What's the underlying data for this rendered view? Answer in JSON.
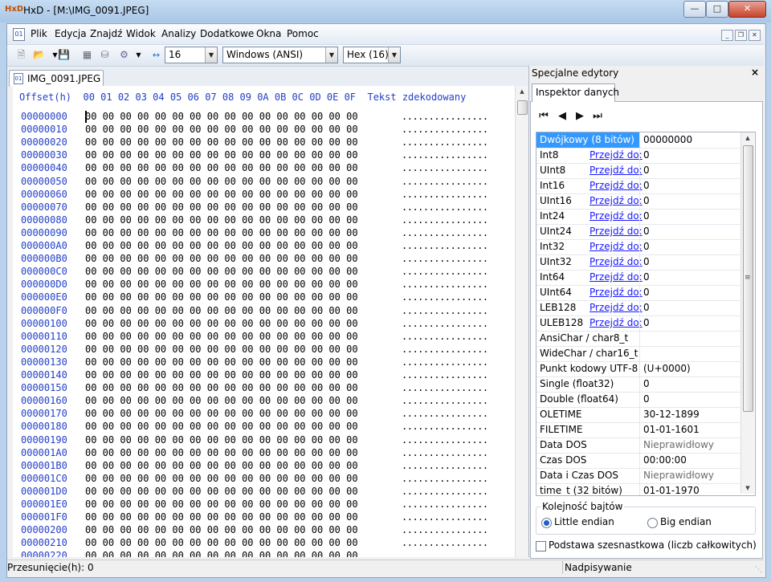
{
  "window": {
    "title": "HxD - [M:\\IMG_0091.JPEG]",
    "app_icon": "HxD"
  },
  "menu": [
    "Plik",
    "Edycja",
    "Znajdź",
    "Widok",
    "Analizy",
    "Dodatkowe",
    "Okna",
    "Pomoc"
  ],
  "toolbar": {
    "bytes_per_row": "16",
    "charset": "Windows (ANSI)",
    "offset_base": "Hex (16)"
  },
  "file_tab": {
    "label": "IMG_0091.JPEG"
  },
  "hex_view": {
    "header": "Offset(h)  00 01 02 03 04 05 06 07 08 09 0A 0B 0C 0D 0E 0F  Tekst zdekodowany",
    "offsets": [
      "00000000",
      "00000010",
      "00000020",
      "00000030",
      "00000040",
      "00000050",
      "00000060",
      "00000070",
      "00000080",
      "00000090",
      "000000A0",
      "000000B0",
      "000000C0",
      "000000D0",
      "000000E0",
      "000000F0",
      "00000100",
      "00000110",
      "00000120",
      "00000130",
      "00000140",
      "00000150",
      "00000160",
      "00000170",
      "00000180",
      "00000190",
      "000001A0",
      "000001B0",
      "000001C0",
      "000001D0",
      "000001E0",
      "000001F0",
      "00000200",
      "00000210",
      "00000220"
    ],
    "row_bytes": "00 00 00 00 00 00 00 00 00 00 00 00 00 00 00 00",
    "row_text": "................"
  },
  "side_panel": {
    "title": "Specjalne edytory",
    "tab": "Inspektor danych",
    "nav_icons": [
      "first-icon",
      "prev-icon",
      "next-icon",
      "last-icon"
    ],
    "rows": [
      {
        "name": "Dwójkowy (8 bitów)",
        "link": "",
        "value": "00000000",
        "selected": true
      },
      {
        "name": "Int8",
        "link": "Przejdź do:",
        "value": "0"
      },
      {
        "name": "UInt8",
        "link": "Przejdź do:",
        "value": "0"
      },
      {
        "name": "Int16",
        "link": "Przejdź do:",
        "value": "0"
      },
      {
        "name": "UInt16",
        "link": "Przejdź do:",
        "value": "0"
      },
      {
        "name": "Int24",
        "link": "Przejdź do:",
        "value": "0"
      },
      {
        "name": "UInt24",
        "link": "Przejdź do:",
        "value": "0"
      },
      {
        "name": "Int32",
        "link": "Przejdź do:",
        "value": "0"
      },
      {
        "name": "UInt32",
        "link": "Przejdź do:",
        "value": "0"
      },
      {
        "name": "Int64",
        "link": "Przejdź do:",
        "value": "0"
      },
      {
        "name": "UInt64",
        "link": "Przejdź do:",
        "value": "0"
      },
      {
        "name": "LEB128",
        "link": "Przejdź do:",
        "value": "0"
      },
      {
        "name": "ULEB128",
        "link": "Przejdź do:",
        "value": "0"
      },
      {
        "name": "AnsiChar / char8_t",
        "link": "",
        "value": ""
      },
      {
        "name": "WideChar / char16_t",
        "link": "",
        "value": ""
      },
      {
        "name": "Punkt kodowy UTF-8",
        "link": "",
        "value": "  (U+0000)"
      },
      {
        "name": "Single (float32)",
        "link": "",
        "value": "0"
      },
      {
        "name": "Double (float64)",
        "link": "",
        "value": "0"
      },
      {
        "name": "OLETIME",
        "link": "",
        "value": "30-12-1899"
      },
      {
        "name": "FILETIME",
        "link": "",
        "value": "01-01-1601"
      },
      {
        "name": "Data DOS",
        "link": "",
        "value": "Nieprawidłowy",
        "muted": true
      },
      {
        "name": "Czas DOS",
        "link": "",
        "value": "00:00:00"
      },
      {
        "name": "Data i Czas DOS",
        "link": "",
        "value": "Nieprawidłowy",
        "muted": true
      },
      {
        "name": "time_t (32 bitów)",
        "link": "",
        "value": "01-01-1970"
      }
    ],
    "byte_order": {
      "title": "Kolejność bajtów",
      "little": "Little endian",
      "big": "Big endian",
      "selected": "little"
    },
    "hex_base_label": "Podstawa szesnastkowa (liczb całkowitych)"
  },
  "status": {
    "offset": "Przesunięcie(h): 0",
    "mode": "Nadpisywanie"
  }
}
